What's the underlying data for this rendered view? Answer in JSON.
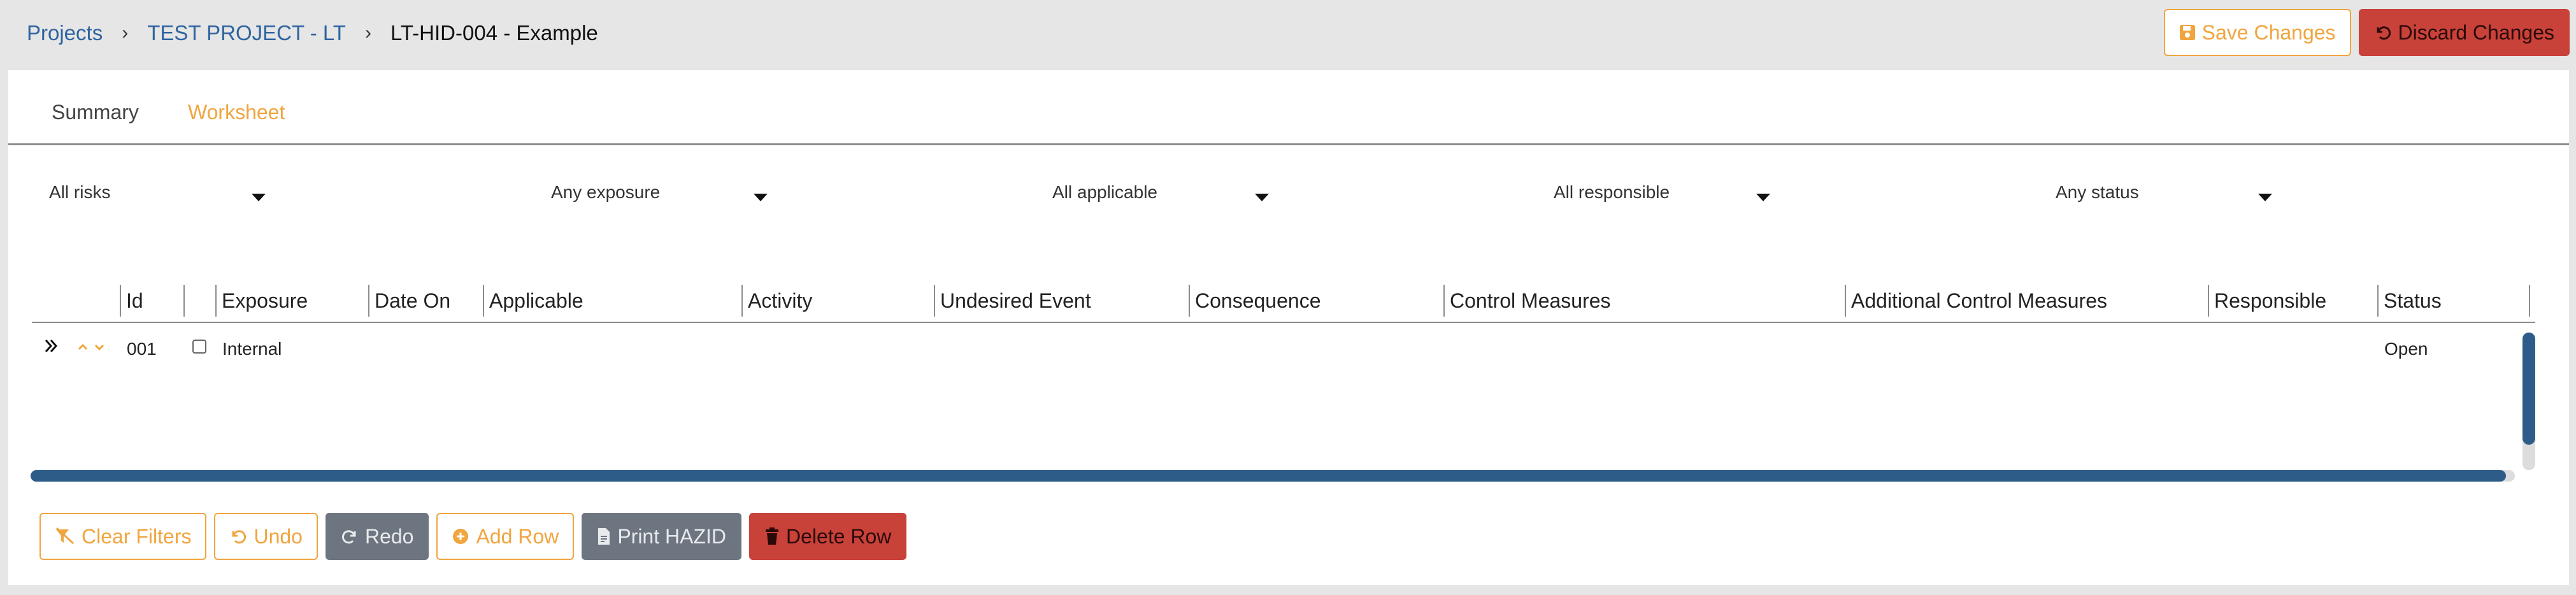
{
  "breadcrumb": {
    "projects": "Projects",
    "project": "TEST PROJECT - LT",
    "separator": "›",
    "current": "LT-HID-004 - Example"
  },
  "top_actions": {
    "save": "Save Changes",
    "discard": "Discard Changes"
  },
  "tabs": {
    "summary": "Summary",
    "worksheet": "Worksheet",
    "active": "Worksheet"
  },
  "filters": {
    "risks": "All risks",
    "exposure": "Any exposure",
    "applicable": "All applicable",
    "responsible": "All responsible",
    "status": "Any status"
  },
  "table": {
    "columns": {
      "id": "Id",
      "exposure": "Exposure",
      "date_on": "Date On",
      "applicable": "Applicable",
      "activity": "Activity",
      "undesired_event": "Undesired Event",
      "consequence": "Consequence",
      "control_measures": "Control Measures",
      "additional_control_measures": "Additional Control Measures",
      "responsible": "Responsible",
      "status": "Status"
    },
    "rows": [
      {
        "id": "001",
        "exposure": "Internal",
        "date_on": "",
        "applicable": "",
        "activity": "",
        "undesired_event": "",
        "consequence": "",
        "control_measures": "",
        "additional_control_measures": "",
        "responsible": "",
        "status": "Open",
        "checked": false
      }
    ]
  },
  "bottom_actions": {
    "clear_filters": "Clear Filters",
    "undo": "Undo",
    "redo": "Redo",
    "add_row": "Add Row",
    "print_hazid": "Print HAZID",
    "delete_row": "Delete Row"
  },
  "colors": {
    "accent_orange": "#f0a53f",
    "link_blue": "#2f64a0",
    "danger_red": "#c9423a",
    "disabled_gray": "#6d7580",
    "scroll_blue": "#2d5c88"
  }
}
